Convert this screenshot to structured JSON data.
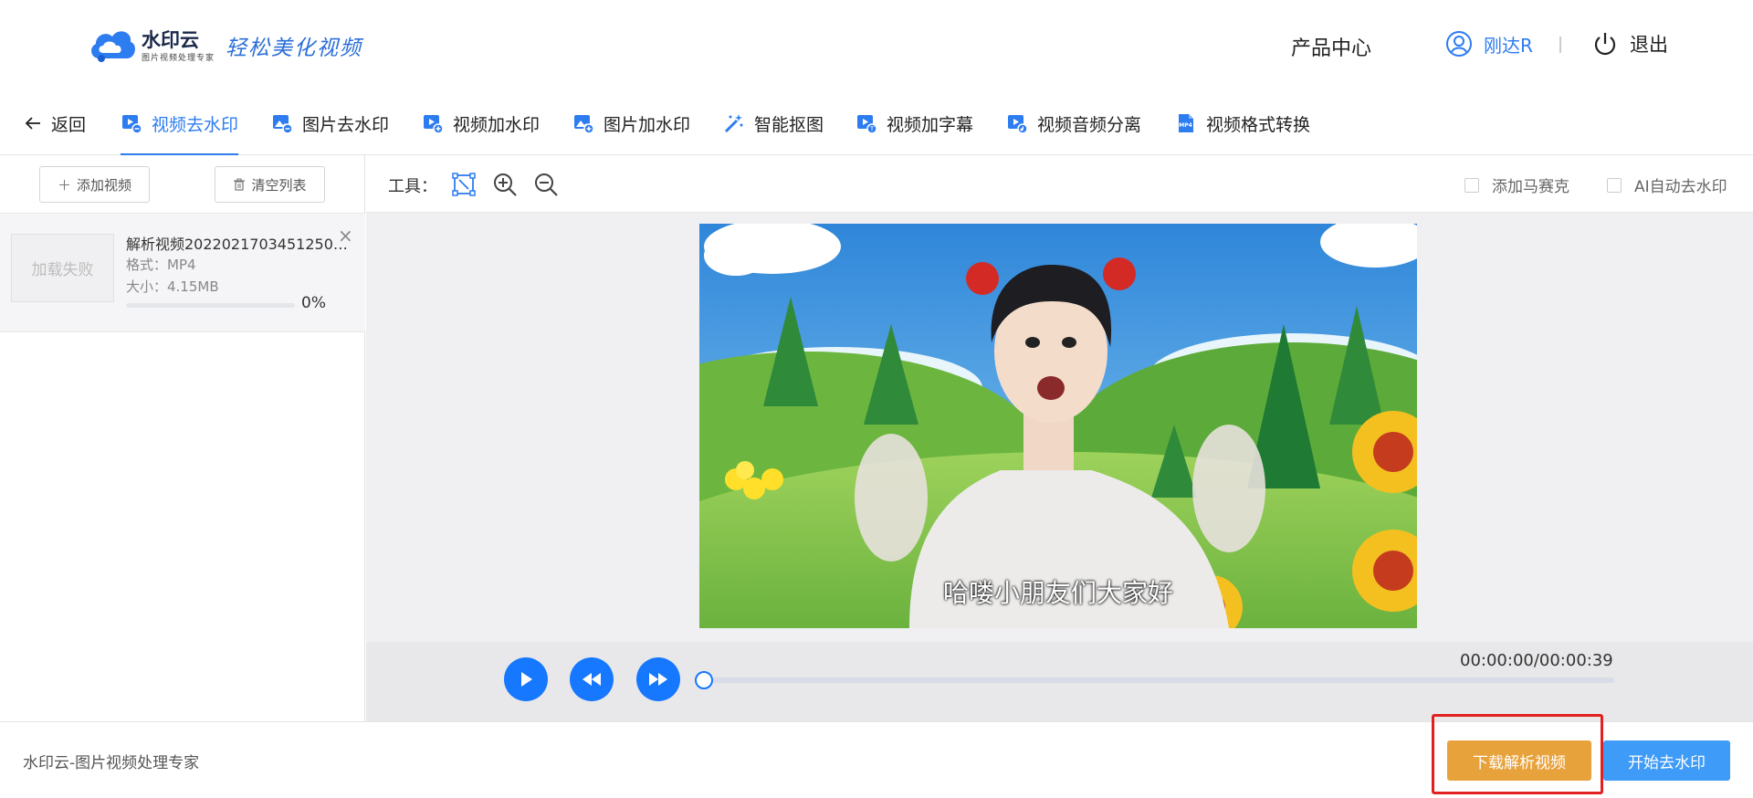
{
  "header": {
    "logo_name": "水印云",
    "logo_sub": "图片视频处理专家",
    "logo_slogan": "轻松美化视频",
    "product_center": "产品中心",
    "username": "刚达R",
    "logout": "退出"
  },
  "tabs": {
    "back": "返回",
    "items": [
      {
        "label": "视频去水印",
        "icon": "video-remove-icon"
      },
      {
        "label": "图片去水印",
        "icon": "image-remove-icon"
      },
      {
        "label": "视频加水印",
        "icon": "video-add-icon"
      },
      {
        "label": "图片加水印",
        "icon": "image-add-icon"
      },
      {
        "label": "智能抠图",
        "icon": "magic-wand-icon"
      },
      {
        "label": "视频加字幕",
        "icon": "video-subtitle-icon"
      },
      {
        "label": "视频音频分离",
        "icon": "video-audio-icon"
      },
      {
        "label": "视频格式转换",
        "icon": "mp4-file-icon"
      }
    ]
  },
  "left": {
    "add_video": "添加视频",
    "clear_list": "清空列表",
    "file": {
      "thumb_text": "加载失败",
      "name": "解析视频20220217034512508...",
      "format": "格式：MP4",
      "size": "大小：4.15MB",
      "progress": 0,
      "progress_text": "0%",
      "close": "×"
    }
  },
  "toolbar": {
    "label": "工具：",
    "mosaic": "添加马赛克",
    "ai_remove": "AI自动去水印"
  },
  "preview": {
    "caption": "哈喽小朋友们大家好"
  },
  "player": {
    "time": "00:00:00/00:00:39",
    "progress": 0
  },
  "footer": {
    "text": "水印云-图片视频处理专家",
    "download": "下载解析视频",
    "start": "开始去水印"
  },
  "colors": {
    "accent": "#2d7cf0",
    "download_btn": "#e8a23c",
    "start_btn": "#3e9bf7",
    "highlight": "#e32020"
  }
}
